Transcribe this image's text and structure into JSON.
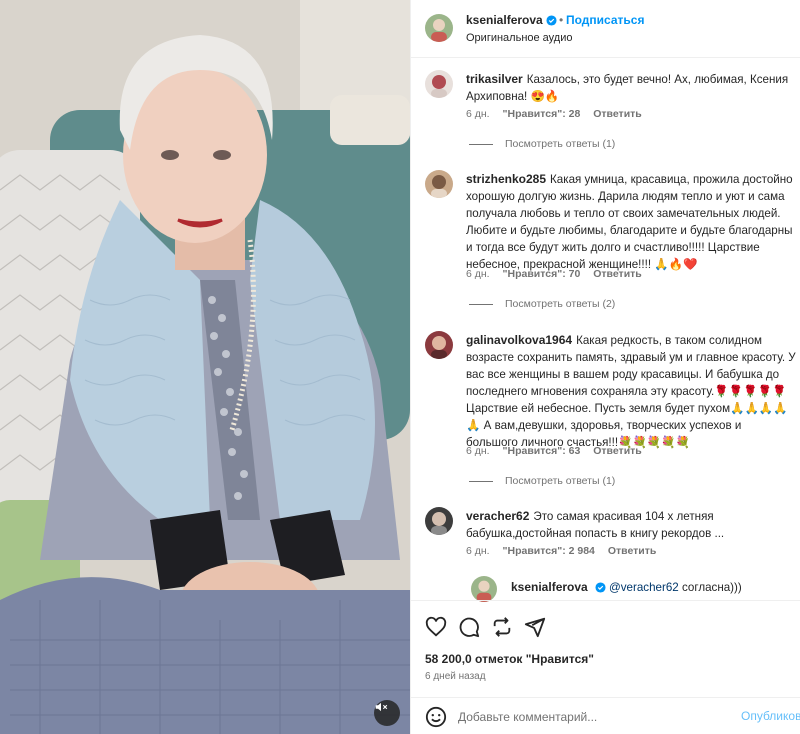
{
  "post": {
    "author": "ksenialferova",
    "follow_label": "Подписаться",
    "separator": "•",
    "audio": "Оригинальное аудио",
    "likes_text": "58 200,0 отметок \"Нравится\"",
    "date": "6 дней назад"
  },
  "comments": [
    {
      "user": "trikasilver",
      "text": "Казалось, это будет вечно! Ах, любимая, Ксения Архиповна! 😍🔥",
      "time": "6 дн.",
      "likes": "\"Нравится\": 28",
      "reply_label": "Ответить",
      "view_replies": "Посмотреть ответы (1)"
    },
    {
      "user": "strizhenko285",
      "text": "Какая умница, красавица, прожила достойно хорошую долгую жизнь. Дарила людям тепло и уют и сама получала любовь и тепло от своих замечательных людей. Любите и будьте любимы, благодарите и будьте благодарны и тогда все будут жить долго и счастливо!!!!! Царствие небесное, прекрасной женщине!!!! 🙏🔥❤️",
      "time": "6 дн.",
      "likes": "\"Нравится\": 70",
      "reply_label": "Ответить",
      "view_replies": "Посмотреть ответы (2)"
    },
    {
      "user": "galinavolkova1964",
      "text": "Какая редкость, в таком солидном возрасте сохранить память, здравый ум и главное красоту. У вас все женщины в вашем роду красавицы. И бабушка до последнего мгновения сохраняла эту красоту.🌹🌹🌹🌹🌹 Царствие ей небесное. Пусть земля будет пухом🙏🙏🙏🙏🙏 А вам,девушки, здоровья, творческих успехов и большого личного счастья!!!💐💐💐💐💐",
      "time": "6 дн.",
      "likes": "\"Нравится\": 63",
      "reply_label": "Ответить",
      "view_replies": "Посмотреть ответы (1)"
    },
    {
      "user": "veracher62",
      "text": "Это самая красивая 104 х летняя бабушка,достойная попасть в книгу рекордов ...",
      "time": "6 дн.",
      "likes": "\"Нравится\": 2 984",
      "reply_label": "Ответить"
    }
  ],
  "reply": {
    "user": "ksenialferova",
    "mention": "@veracher62",
    "text": "согласна)))"
  },
  "composer": {
    "placeholder": "Добавьте комментарий...",
    "publish_label": "Опубликовать"
  },
  "icons": [
    "verified-badge-icon",
    "heart-icon",
    "comment-icon",
    "repost-icon",
    "share-icon",
    "emoji-icon",
    "mute-icon"
  ],
  "colors": {
    "link": "#0095f6",
    "verified": "#0095f6",
    "muted_text": "#737373",
    "text": "#262626"
  }
}
